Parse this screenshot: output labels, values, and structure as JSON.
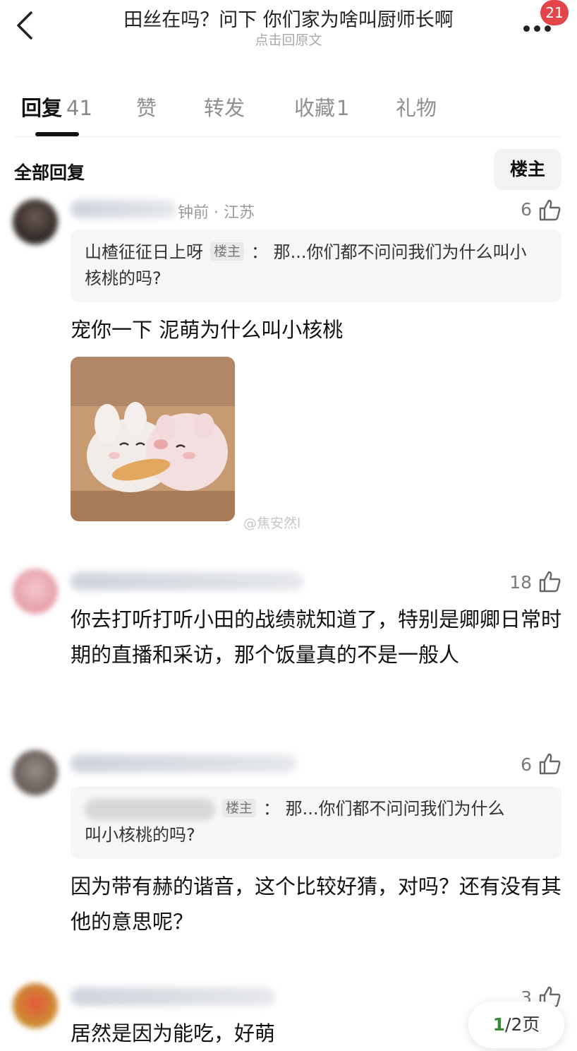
{
  "header": {
    "back_icon": "chevron-left-icon",
    "title": "田丝在吗？问下 你们家为啥叫厨师长啊",
    "subtitle": "点击回原文",
    "more_icon": "more-dots-icon",
    "notification_count": "21"
  },
  "tabs": [
    {
      "label": "回复",
      "count": "41"
    },
    {
      "label": "赞",
      "count": ""
    },
    {
      "label": "转发",
      "count": ""
    },
    {
      "label": "收藏",
      "count": "1"
    },
    {
      "label": "礼物",
      "count": ""
    }
  ],
  "section": {
    "title": "全部回复",
    "filter_label": "楼主"
  },
  "comments": [
    {
      "meta_visible": "钟前 · 江苏",
      "likes": "6",
      "quote_user": "山楂征征日上呀",
      "quote_tag": "楼主",
      "quote_sep": "：",
      "quote_text": "那...你们都不问问我们为什么叫小核桃的吗?",
      "text": "宠你一下 泥萌为什么叫小核桃",
      "watermark": "@焦安然l"
    },
    {
      "likes": "18",
      "text": "你去打听打听小田的战绩就知道了，特别是卿卿日常时期的直播和采访，那个饭量真的不是一般人"
    },
    {
      "likes": "6",
      "quote_tag": "楼主",
      "quote_sep": "：",
      "quote_text_line1": "那...你们都不问问我们为什么",
      "quote_text_line2": "叫小核桃的吗?",
      "text": "因为带有赫的谐音，这个比较好猜，对吗？还有没有其他的意思呢？"
    },
    {
      "likes": "3",
      "text": "居然是因为能吃，好萌"
    }
  ],
  "pager": {
    "current": "1",
    "total": "/2页"
  },
  "colors": {
    "badge": "#e3454a",
    "pager_current": "#3a8a3a",
    "quote_bg": "#f6f6f6"
  }
}
